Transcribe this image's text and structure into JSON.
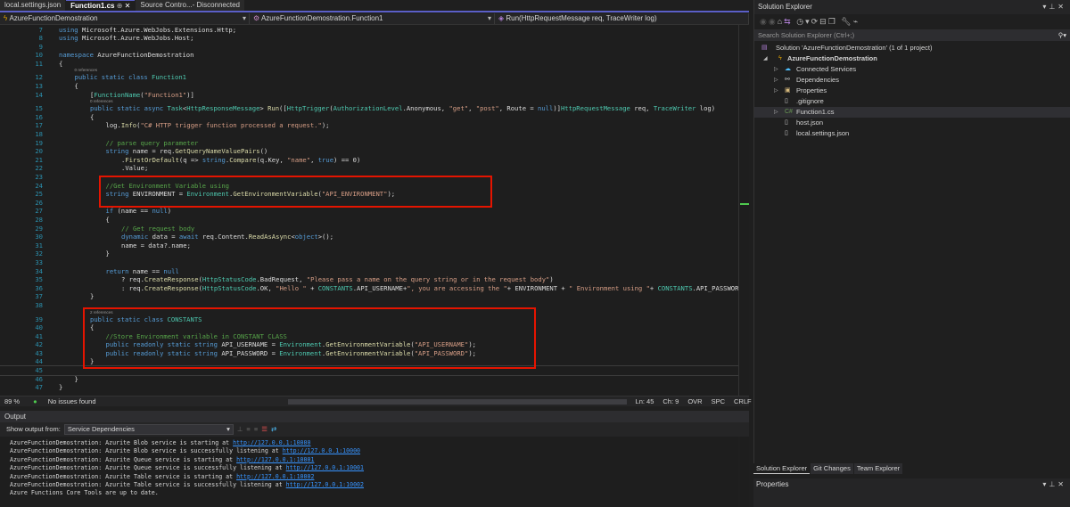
{
  "tabs": [
    {
      "label": "local.settings.json",
      "active": false
    },
    {
      "label": "Function1.cs",
      "active": true,
      "pin": "⊕",
      "close": "✕"
    },
    {
      "label": "Source Contro...- Disconnected",
      "active": false
    }
  ],
  "navbar": {
    "project": "AzureFunctionDemostration",
    "class": "AzureFunctionDemostration.Function1",
    "member": "Run(HttpRequestMessage req, TraceWriter log)"
  },
  "code": [
    {
      "n": "7",
      "i": 0,
      "tk": [
        [
          "using",
          "k"
        ],
        [
          " Microsoft.Azure.WebJobs.Extensions.Http;",
          "p"
        ]
      ]
    },
    {
      "n": "8",
      "i": 0,
      "tk": [
        [
          "using",
          "k"
        ],
        [
          " Microsoft.Azure.WebJobs.Host;",
          "p"
        ]
      ]
    },
    {
      "n": "9",
      "i": 0,
      "tk": []
    },
    {
      "n": "10",
      "i": 0,
      "tk": [
        [
          "namespace",
          "k"
        ],
        [
          " AzureFunctionDemostration",
          "p"
        ]
      ]
    },
    {
      "n": "11",
      "i": 0,
      "tk": [
        [
          "{",
          "p"
        ]
      ]
    },
    {
      "ref": "0 references",
      "i": 1
    },
    {
      "n": "12",
      "i": 1,
      "tk": [
        [
          "public static class",
          "k"
        ],
        [
          " Function1",
          "t"
        ]
      ]
    },
    {
      "n": "13",
      "i": 1,
      "tk": [
        [
          "{",
          "p"
        ]
      ]
    },
    {
      "n": "14",
      "i": 2,
      "tk": [
        [
          "[",
          "p"
        ],
        [
          "FunctionName",
          "t"
        ],
        [
          "(",
          "p"
        ],
        [
          "\"Function1\"",
          "s"
        ],
        [
          ")]",
          "p"
        ]
      ]
    },
    {
      "ref": "0 references",
      "i": 2
    },
    {
      "n": "15",
      "i": 2,
      "tk": [
        [
          "public static async",
          "k"
        ],
        [
          " Task",
          "t"
        ],
        [
          "<",
          "p"
        ],
        [
          "HttpResponseMessage",
          "t"
        ],
        [
          "> ",
          "p"
        ],
        [
          "Run",
          "m"
        ],
        [
          "([",
          "p"
        ],
        [
          "HttpTrigger",
          "t"
        ],
        [
          "(",
          "p"
        ],
        [
          "AuthorizationLevel",
          "t"
        ],
        [
          ".Anonymous, ",
          "p"
        ],
        [
          "\"get\"",
          "s"
        ],
        [
          ", ",
          "p"
        ],
        [
          "\"post\"",
          "s"
        ],
        [
          ", Route = ",
          "p"
        ],
        [
          "null",
          "k"
        ],
        [
          ")]",
          "p"
        ],
        [
          "HttpRequestMessage",
          "t"
        ],
        [
          " req, ",
          "p"
        ],
        [
          "TraceWriter",
          "t"
        ],
        [
          " log)",
          "p"
        ]
      ]
    },
    {
      "n": "16",
      "i": 2,
      "tk": [
        [
          "{",
          "p"
        ]
      ]
    },
    {
      "n": "17",
      "i": 3,
      "tk": [
        [
          "log.",
          "p"
        ],
        [
          "Info",
          "m"
        ],
        [
          "(",
          "p"
        ],
        [
          "\"C# HTTP trigger function processed a request.\"",
          "s"
        ],
        [
          ");",
          "p"
        ]
      ]
    },
    {
      "n": "18",
      "i": 3,
      "tk": []
    },
    {
      "n": "19",
      "i": 3,
      "tk": [
        [
          "// parse query parameter",
          "c"
        ]
      ]
    },
    {
      "n": "20",
      "i": 3,
      "tk": [
        [
          "string",
          "k"
        ],
        [
          " name = req.",
          "p"
        ],
        [
          "GetQueryNameValuePairs",
          "m"
        ],
        [
          "()",
          "p"
        ]
      ]
    },
    {
      "n": "21",
      "i": 4,
      "tk": [
        [
          ".",
          "p"
        ],
        [
          "FirstOrDefault",
          "m"
        ],
        [
          "(q => ",
          "p"
        ],
        [
          "string",
          "k"
        ],
        [
          ".",
          "p"
        ],
        [
          "Compare",
          "m"
        ],
        [
          "(q.Key, ",
          "p"
        ],
        [
          "\"name\"",
          "s"
        ],
        [
          ", ",
          "p"
        ],
        [
          "true",
          "k"
        ],
        [
          ") == 0)",
          "p"
        ]
      ]
    },
    {
      "n": "22",
      "i": 4,
      "tk": [
        [
          ".Value;",
          "p"
        ]
      ]
    },
    {
      "n": "23",
      "i": 3,
      "tk": []
    },
    {
      "n": "24",
      "i": 3,
      "tk": [
        [
          "//Get Environment Variable using",
          "c"
        ]
      ]
    },
    {
      "n": "25",
      "i": 3,
      "tk": [
        [
          "string",
          "k"
        ],
        [
          " ENVIRONMENT = ",
          "p"
        ],
        [
          "Environment",
          "t"
        ],
        [
          ".",
          "p"
        ],
        [
          "GetEnvironmentVariable",
          "m"
        ],
        [
          "(",
          "p"
        ],
        [
          "\"API_ENVIRONMENT\"",
          "s"
        ],
        [
          ");",
          "p"
        ]
      ]
    },
    {
      "n": "26",
      "i": 3,
      "tk": []
    },
    {
      "n": "27",
      "i": 3,
      "tk": [
        [
          "if",
          "k"
        ],
        [
          " (name == ",
          "p"
        ],
        [
          "null",
          "k"
        ],
        [
          ")",
          "p"
        ]
      ]
    },
    {
      "n": "28",
      "i": 3,
      "tk": [
        [
          "{",
          "p"
        ]
      ]
    },
    {
      "n": "29",
      "i": 4,
      "tk": [
        [
          "// Get request body",
          "c"
        ]
      ]
    },
    {
      "n": "30",
      "i": 4,
      "tk": [
        [
          "dynamic",
          "k"
        ],
        [
          " data = ",
          "p"
        ],
        [
          "await",
          "k"
        ],
        [
          " req.Content.",
          "p"
        ],
        [
          "ReadAsAsync",
          "m"
        ],
        [
          "<",
          "p"
        ],
        [
          "object",
          "k"
        ],
        [
          ">();",
          "p"
        ]
      ]
    },
    {
      "n": "31",
      "i": 4,
      "tk": [
        [
          "name = data?.name;",
          "p"
        ]
      ]
    },
    {
      "n": "32",
      "i": 3,
      "tk": [
        [
          "}",
          "p"
        ]
      ]
    },
    {
      "n": "33",
      "i": 3,
      "tk": []
    },
    {
      "n": "34",
      "i": 3,
      "tk": [
        [
          "return",
          "k"
        ],
        [
          " name == ",
          "p"
        ],
        [
          "null",
          "k"
        ]
      ]
    },
    {
      "n": "35",
      "i": 4,
      "tk": [
        [
          "? req.",
          "p"
        ],
        [
          "CreateResponse",
          "m"
        ],
        [
          "(",
          "p"
        ],
        [
          "HttpStatusCode",
          "t"
        ],
        [
          ".BadRequest, ",
          "p"
        ],
        [
          "\"Please pass a name on the query string or in the request body\"",
          "s"
        ],
        [
          ")",
          "p"
        ]
      ]
    },
    {
      "n": "36",
      "i": 4,
      "tk": [
        [
          ": req.",
          "p"
        ],
        [
          "CreateResponse",
          "m"
        ],
        [
          "(",
          "p"
        ],
        [
          "HttpStatusCode",
          "t"
        ],
        [
          ".OK, ",
          "p"
        ],
        [
          "\"Hello \"",
          "s"
        ],
        [
          " + ",
          "p"
        ],
        [
          "CONSTANTS",
          "t"
        ],
        [
          ".API_USERNAME+",
          "p"
        ],
        [
          "\", you are accessing the \"",
          "s"
        ],
        [
          "+ ENVIRONMENT + ",
          "p"
        ],
        [
          "\" Environment using \"",
          "s"
        ],
        [
          "+ ",
          "p"
        ],
        [
          "CONSTANTS",
          "t"
        ],
        [
          ".API_PASSWORD",
          "p"
        ]
      ]
    },
    {
      "n": "37",
      "i": 2,
      "tk": [
        [
          "}",
          "p"
        ]
      ]
    },
    {
      "n": "38",
      "i": 2,
      "tk": []
    },
    {
      "ref": "2 references",
      "i": 2
    },
    {
      "n": "39",
      "i": 2,
      "tk": [
        [
          "public static class",
          "k"
        ],
        [
          " CONSTANTS",
          "t"
        ]
      ]
    },
    {
      "n": "40",
      "i": 2,
      "tk": [
        [
          "{",
          "p"
        ]
      ]
    },
    {
      "n": "41",
      "i": 3,
      "tk": [
        [
          "//Store Environment varilable in CONSTANT CLASS",
          "c"
        ]
      ]
    },
    {
      "n": "42",
      "i": 3,
      "tk": [
        [
          "public readonly static string",
          "k"
        ],
        [
          " API_USERNAME = ",
          "p"
        ],
        [
          "Environment",
          "t"
        ],
        [
          ".",
          "p"
        ],
        [
          "GetEnvironmentVariable",
          "m"
        ],
        [
          "(",
          "p"
        ],
        [
          "\"API_USERNAME\"",
          "s"
        ],
        [
          ");",
          "p"
        ]
      ]
    },
    {
      "n": "43",
      "i": 3,
      "tk": [
        [
          "public readonly static string",
          "k"
        ],
        [
          " API_PASSWORD = ",
          "p"
        ],
        [
          "Environment",
          "t"
        ],
        [
          ".",
          "p"
        ],
        [
          "GetEnvironmentVariable",
          "m"
        ],
        [
          "(",
          "p"
        ],
        [
          "\"API_PASSWORD\"",
          "s"
        ],
        [
          ");",
          "p"
        ]
      ]
    },
    {
      "n": "44",
      "i": 2,
      "tk": [
        [
          "}",
          "p"
        ]
      ]
    },
    {
      "n": "45",
      "i": 2,
      "tk": [],
      "current": true
    },
    {
      "n": "46",
      "i": 1,
      "tk": [
        [
          "}",
          "p"
        ]
      ]
    },
    {
      "n": "47",
      "i": 0,
      "tk": [
        [
          "}",
          "p"
        ]
      ]
    }
  ],
  "status": {
    "zoom": "89 %",
    "issues": "No issues found",
    "ln": "Ln: 45",
    "ch": "Ch: 9",
    "ovr": "OVR",
    "spc": "SPC",
    "crlf": "CRLF"
  },
  "output": {
    "title": "Output",
    "show_from_label": "Show output from:",
    "source": "Service Dependencies",
    "lines": [
      {
        "text": "AzureFunctionDemostration: Azurite Blob service is starting at ",
        "url": "http://127.0.0.1:10000"
      },
      {
        "text": "AzureFunctionDemostration: Azurite Blob service is successfully listening at ",
        "url": "http://127.0.0.1:10000"
      },
      {
        "text": "AzureFunctionDemostration: Azurite Queue service is starting at ",
        "url": "http://127.0.0.1:10001"
      },
      {
        "text": "AzureFunctionDemostration: Azurite Queue service is successfully listening at ",
        "url": "http://127.0.0.1:10001"
      },
      {
        "text": "AzureFunctionDemostration: Azurite Table service is starting at ",
        "url": "http://127.0.0.1:10002"
      },
      {
        "text": "AzureFunctionDemostration: Azurite Table service is successfully listening at ",
        "url": "http://127.0.0.1:10002"
      },
      {
        "text": "Azure Functions Core Tools are up to date.",
        "url": null
      }
    ]
  },
  "solution_explorer": {
    "title": "Solution Explorer",
    "search_placeholder": "Search Solution Explorer (Ctrl+;)",
    "solution": "Solution 'AzureFunctionDemostration' (1 of 1 project)",
    "project": "AzureFunctionDemostration",
    "items": [
      {
        "label": "Connected Services",
        "icon": "connected-services-icon",
        "glyph": "☁",
        "color": "#4fc1ff",
        "expandable": true
      },
      {
        "label": "Dependencies",
        "icon": "dependencies-icon",
        "glyph": "⚯",
        "color": "#ccc",
        "expandable": true
      },
      {
        "label": "Properties",
        "icon": "properties-icon",
        "glyph": "▣",
        "color": "#d7ba7d",
        "expandable": true
      },
      {
        "label": ".gitignore",
        "icon": "file-icon",
        "glyph": "▯",
        "color": "#ccc",
        "expandable": false
      },
      {
        "label": "Function1.cs",
        "icon": "csharp-file-icon",
        "glyph": "C#",
        "color": "#6a9955",
        "expandable": true,
        "selected": true
      },
      {
        "label": "host.json",
        "icon": "json-file-icon",
        "glyph": "▯",
        "color": "#ccc",
        "expandable": false
      },
      {
        "label": "local.settings.json",
        "icon": "json-file-icon",
        "glyph": "▯",
        "color": "#ccc",
        "expandable": false
      }
    ],
    "bottom_tabs": [
      "Solution Explorer",
      "Git Changes",
      "Team Explorer"
    ]
  },
  "properties": {
    "title": "Properties"
  },
  "colors": {
    "accent": "#5b5fc7",
    "highlight_box": "#e51400"
  }
}
